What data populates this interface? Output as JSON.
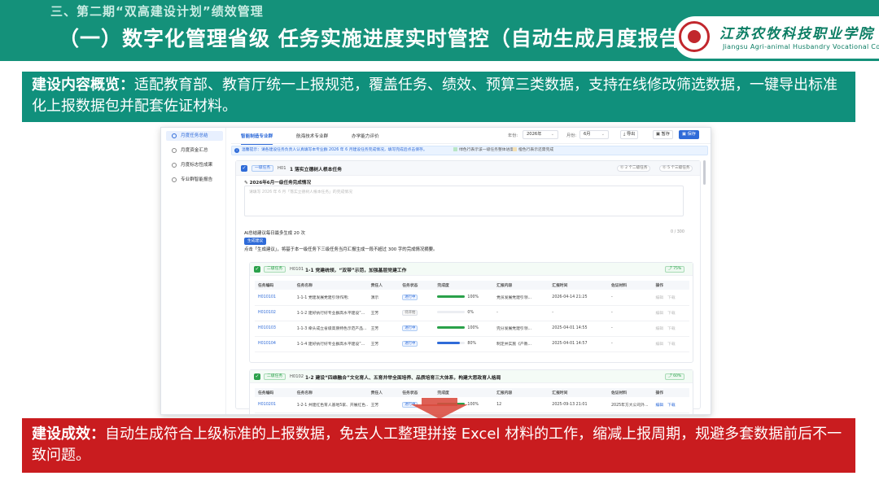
{
  "slide": {
    "subtitle": "三、第二期“双高建设计划”绩效管理",
    "title": "（一）数字化管理省级 任务实施进度实时管控（自动生成月度报告）",
    "logo_cn": "江苏农牧科技职业学院",
    "logo_en": "Jiangsu Agri-animal Husbandry Vocational College",
    "desc_label": "建设内容概览：",
    "desc_text": "适配教育部、教育厅统一上报规范，覆盖任务、绩效、预算三类数据，支持在线修改筛选数据，一键导出标准化上报数据包并配套佐证材料。",
    "result_label": "建设成效：",
    "result_text": "自动生成符合上级标准的上报数据，免去人工整理拼接 Excel 材料的工作，缩减上报周期，规避多套数据前后不一致问题。"
  },
  "colors": {
    "teal": "#14917a",
    "red": "#c91c1f",
    "blue": "#2f6bd8",
    "green": "#2aa14a"
  },
  "app": {
    "sidebar": [
      {
        "label": "月度任务总结",
        "icon": "document-icon",
        "active": true
      },
      {
        "label": "月度资金汇总",
        "icon": "settings-icon",
        "active": false
      },
      {
        "label": "月度标志性成果",
        "icon": "settings-icon",
        "active": false
      },
      {
        "label": "专业群智能报告",
        "icon": "settings-icon",
        "active": false
      }
    ],
    "tabs": [
      "智能制造专业群",
      "航海技术专业群",
      "办学能力评价"
    ],
    "year_label": "年份:",
    "year_value": "2026年",
    "month_label": "月份:",
    "month_value": "6月",
    "export_label": "导出",
    "save_draft_label": "暂存",
    "save_label": "保存",
    "notice": "温馨提示：请各建设任务负责人认真填写本专业群 2026 年 6 月建设任务完成情况，填写完成后点击保存。",
    "legend_done": "绿色行表示该一级任务整体进度",
    "legend_todo": "橙色行表示还需完成",
    "l1_task": {
      "tag": "一级任务",
      "code": "H01",
      "title": "1 落实立德树人根本任务",
      "badge_l2": "2 个二级任务",
      "badge_l3": "5 个三级任务",
      "section": "2026年6月一级任务完成情况",
      "placeholder": "请填写 2026 年 6 月「落实立德树人根本任务」的完成情况",
      "count": "0 / 300",
      "ai_line": "AI总结建议每日最多生成 20 次",
      "gen_button": "生成建议",
      "ai_hint": "点击「生成建议」，将基于本一级任务下三级任务当月汇报生成一段不超过 300 字的完成情况摘要。"
    },
    "table_headers": [
      "任务编码",
      "任务名称",
      "责任人",
      "任务状态",
      "完成度",
      "汇报内容",
      "汇报时间",
      "佐证材料",
      "操作"
    ],
    "l2_tasks": [
      {
        "tag": "二级任务",
        "code": "H0101",
        "title": "1-1 党建统领，“双带”示范，加强基层党建工作",
        "percent": "75%",
        "rows": [
          {
            "code": "H010101",
            "name": "1-1-1 党建发展党建引领作用;",
            "owner": "演示",
            "status": "进行中",
            "progress": 100,
            "progress_text": "100%",
            "report": "党员发展党建引领...",
            "time": "2026-04-14 21:25",
            "evidence": "-",
            "op_edit": "编辑",
            "op_download": "下载",
            "bar_color": "#2aa14a"
          },
          {
            "code": "H010102",
            "name": "1-1-2 建好执行好专业群高水平建设“...",
            "owner": "王芳",
            "status": "待开始",
            "progress": 0,
            "progress_text": "0%",
            "report": "-",
            "time": "-",
            "evidence": "-",
            "op_edit": "编辑",
            "op_download": "下载",
            "bar_color": "#2aa14a"
          },
          {
            "code": "H010103",
            "name": "1-1-3 牵头成立省级高质特色示范产品...",
            "owner": "王芳",
            "status": "进行中",
            "progress": 100,
            "progress_text": "100%",
            "report": "完分发展党建引领...",
            "time": "2025-04-01 14:55",
            "evidence": "-",
            "op_edit": "编辑",
            "op_download": "下载",
            "bar_color": "#2aa14a"
          },
          {
            "code": "H010104",
            "name": "1-1-4 建好执行好专业群高水平建设“...",
            "owner": "王芳",
            "status": "进行中",
            "progress": 80,
            "progress_text": "80%",
            "report": "制定并实施《产教...",
            "time": "2025-04-01 14:57",
            "evidence": "-",
            "op_edit": "编辑",
            "op_download": "下载",
            "bar_color": "#2f6bd8"
          }
        ]
      },
      {
        "tag": "二级任务",
        "code": "H0102",
        "title": "1-2 建设“四维融合”文化育人、五育并举全面培养、品质培育三大体系，构建大思政育人格局",
        "percent": "60%",
        "rows": [
          {
            "code": "H010201",
            "name": "1-2-1 共建红色育人基地5家、开展红色...",
            "owner": "王芳",
            "status": "进行中",
            "progress": 100,
            "progress_text": "100%",
            "report": "12",
            "time": "2025-09-13 21:01",
            "evidence": "2025年方大公司外...",
            "op_edit": "编辑",
            "op_download": "下载",
            "bar_color": "#2aa14a"
          }
        ]
      }
    ]
  }
}
